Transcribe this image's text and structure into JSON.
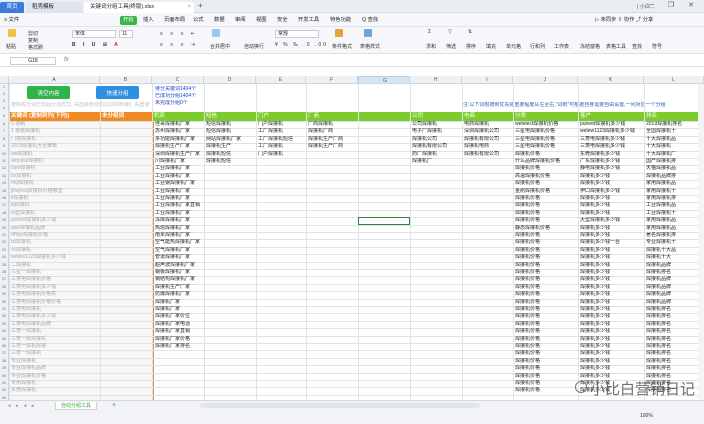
{
  "window": {
    "home_tab": "首页",
    "tab1": "稻壳模板",
    "tab2": "关键词分组工具(终版).xlsx",
    "user": "| 小白...",
    "controls": "─ ❐ ✕"
  },
  "menu": {
    "file": "≡ 文件",
    "start": "开始",
    "insert": "插入",
    "layout": "页面布局",
    "formula": "公式",
    "data": "数据",
    "review": "审阅",
    "view": "视图",
    "safe": "安全",
    "dev": "开发工具",
    "special": "特色功能",
    "search": "Q 查找",
    "right": "▷ 未同步  ⇧ 协作  ⤴ 分享"
  },
  "ribbon": {
    "paste": "粘贴",
    "cut": "剪切",
    "copy": "复制",
    "format_painter": "格式刷",
    "font": "宋体",
    "size": "11",
    "merge": "合并居中",
    "wrap": "自动换行",
    "number_format": "常规",
    "cond": "条件格式",
    "cell_style": "表格样式",
    "sum": "求和",
    "filter": "筛选",
    "sort": "排序",
    "fill": "填充",
    "cells": "单元格",
    "rowcol": "行和列",
    "worksheet": "工作表",
    "freeze": "冻结窗格",
    "tools": "表格工具",
    "find": "查找",
    "symbol": "符号"
  },
  "formula_bar": {
    "cell_ref": "G18",
    "fx": "fx"
  },
  "columns": [
    "A",
    "B",
    "C",
    "D",
    "E",
    "F",
    "G",
    "H",
    "I",
    "J",
    "K"
  ],
  "buttons": {
    "clear": "清空内容",
    "group": "快速分组"
  },
  "stats": [
    "待分关键词1404个",
    "已成功分组1404个",
    "未完成分组0个"
  ],
  "hint_a": "按照先分词方式后分词方式, 先选择自动词(1022989条), 先登录选择...",
  "note": "注:以下词根按照优先级重要程度从左至右,“词根”可根据自身需要自由设置,一列对应一个分组",
  "header_a": "关键词 (复制到列(下列))",
  "header_b": "未分组词",
  "groups": [
    "机床",
    "短信",
    "门户",
    "厂商",
    "",
    "公司",
    "电商",
    "分类",
    "客户",
    "",
    "排名"
  ],
  "col_a": [
    "1 卓刷",
    "1 卷装焊接机",
    "门镜焊接机",
    "2019焊接机大全推荐",
    "aw焊接机",
    "airpulse焊接机",
    "bsm焊接机",
    "bs焊接机",
    "hhjl焊接机",
    "jlhsjnxq焊接机价格哪里",
    "li焊接机",
    "kj焊接机",
    "m型焊接机",
    "puneet焊接机多少钱",
    "qwe焊接机品牌",
    "rtfhjw焊接机价格",
    "tzl焊接机",
    "vc焊接机",
    "wetew1123焊接机多少钱",
    "二焊接机",
    "三星一焊接机",
    "三菱电焊接机价格",
    "三菱电焊接机多少钱",
    "三菱电焊接机价格表",
    "三菱电焊接机价格价格",
    "三菱电焊接机",
    "三菱电焊接机多少钱",
    "三菱电焊接机品牌",
    "三菱一焊接机",
    "三菱一体焊接机",
    "三菱一体机焊接",
    "三菱一焊接机",
    "专业焊接机",
    "专业焊接机品牌",
    "专业焊接机价格",
    "专用焊接机",
    "东莞焊接机",
    "东莞焊接机价格",
    "东莞焊接机多少钱",
    "东莞焊接机厂家",
    "东莞焊接机品牌"
  ],
  "col_c": [
    "佳哥焊接机厂家",
    "苏州焊接机厂家",
    "多功能焊接机厂家",
    "焊接机生产厂家",
    "深圳焊接机生产厂家",
    "川焊接机厂家",
    "工业焊接机厂家",
    "工业焊接机厂家",
    "工业钢焊接机厂家",
    "工业焊接机厂家",
    "工业焊接机厂家",
    "工业焊接机厂家直销",
    "工业焊接机厂家",
    "冻库焊接机厂家",
    "热熔焊接机厂家",
    "南京焊接机厂家",
    "空气能热焊接机厂家",
    "空气焊接机厂家",
    "管道焊接机厂家",
    "超声波焊接机厂家",
    "钢板焊接机厂家",
    "钢结构焊接机厂家",
    "焊接机生产厂家",
    "防爆焊接机厂家",
    "焊接机厂家",
    "焊接机厂家",
    "焊接机厂家价位",
    "焊接机厂家电话",
    "焊接机厂家直销",
    "焊接机厂家价格",
    "焊接机厂家排名"
  ],
  "col_d": [
    "短信焊接机",
    "短信焊接机",
    "网站焊接机厂家",
    "焊接机生产",
    "焊接机短信",
    "焊接机短信"
  ],
  "col_e": [
    "门户焊接机",
    "工厂焊接机",
    "工厂焊接机短信",
    "工厂焊接机",
    "门户焊接机"
  ],
  "col_f": [
    "厂商焊接机",
    "焊接机厂商",
    "焊接机生产厂商",
    "焊接机生产厂商"
  ],
  "col_h": [
    "公司焊接机",
    "电子厂焊接机",
    "焊接机公司",
    "焊接机有限公司",
    "药厂焊接机",
    "焊接机厂"
  ],
  "col_i": [
    "电商焊接机",
    "深圳焊接机公司",
    "焊接机有限公司",
    "焊接机电商",
    "焊接机有限公司"
  ],
  "col_j": [
    "wetelect焊接机价格",
    "三星电焊接机价格",
    "三星电焊接机价格",
    "三星电焊接机价格",
    "焊接机价格",
    "什么品牌焊接机价格",
    "焊接机价格",
    "高温焊接机价格",
    "焊接机价格",
    "金刚焊接机价格",
    "焊接机价格",
    "焊接机价格",
    "焊接机价格",
    "焊接机价格",
    "静态焊接机价格",
    "焊接机价格",
    "焊接机价格",
    "焊接机价格",
    "焊接机价格",
    "焊接机价格",
    "焊接机价格",
    "焊接机价格",
    "焊接机价格",
    "焊接机价格",
    "焊接机价格",
    "焊接机价格",
    "焊接机价格",
    "焊接机价格",
    "焊接机价格",
    "焊接机价格",
    "焊接机价格",
    "焊接机价格",
    "焊接机价格",
    "焊接机价格",
    "焊接机价格",
    "焊接机价格",
    "焊接机价格",
    "焊接机价格",
    "焊接机价格",
    "焊接机价格",
    "焊接机价格"
  ],
  "col_k": [
    "puneet焊接机多少钱",
    "wetew1123焊接机多少钱",
    "三菱电焊接机多少钱",
    "三菱电焊接机多少钱",
    "东莞焊接机多少钱",
    "广东焊接机多少钱",
    "静电焊接机多少钱",
    "焊接机多少钱",
    "焊接机多少钱",
    "伊口焊接机多少钱",
    "焊接机多少钱",
    "焊接机多少钱",
    "焊接机多少钱",
    "大型焊接机多少钱",
    "焊接机多少钱",
    "焊接机多少钱",
    "焊接机多少钱一台",
    "焊接机多少钱",
    "焊接机多少钱",
    "焊接机多少钱",
    "焊接机多少钱",
    "焊接机多少钱",
    "焊接机多少钱",
    "焊接机多少钱",
    "焊接机多少钱",
    "焊接机多少钱",
    "焊接机多少钱",
    "焊接机多少钱",
    "焊接机多少钱",
    "焊接机多少钱",
    "焊接机多少钱",
    "焊接机多少钱",
    "焊接机多少钱",
    "焊接机多少钱",
    "焊接机多少钱",
    "焊接机多少钱",
    "焊接机多少钱",
    "焊接机多少钱",
    "焊接机多少钱",
    "焊接机多少钱",
    "焊接机多少钱"
  ],
  "col_l": [
    "2019焊接机排名",
    "全国焊接机十",
    "十大焊接机品",
    "十大焊接机",
    "十大焊接机厂",
    "国产焊接机排",
    "天猫焊接机品",
    "焊接机品牌排",
    "家用焊接机品",
    "家用焊接机十",
    "家用焊接机排",
    "工业焊接机品",
    "工业焊接机十",
    "家用焊接机品",
    "家用焊接机品",
    "著名焊接机排",
    "专业焊接机十",
    "焊接机十大品",
    "焊接机十大",
    "焊接机品牌",
    "焊接机排名",
    "焊接机品牌",
    "焊接机品牌",
    "焊接机品牌",
    "焊接机品牌",
    "焊接机排名",
    "焊接机排名",
    "焊接机排名",
    "焊接机排名",
    "焊接机排名",
    "焊接机排名",
    "焊接机排名",
    "焊接机排名",
    "焊接机排名",
    "焊接机排名",
    "焊接机排名",
    "焊接机排名",
    "焊接机排名",
    "焊接机排名",
    "焊接机排名",
    "焊接机排名"
  ],
  "sheet": {
    "tab": "自动分组工具",
    "zoom": "100%"
  },
  "watermark": "小比白营销日记"
}
